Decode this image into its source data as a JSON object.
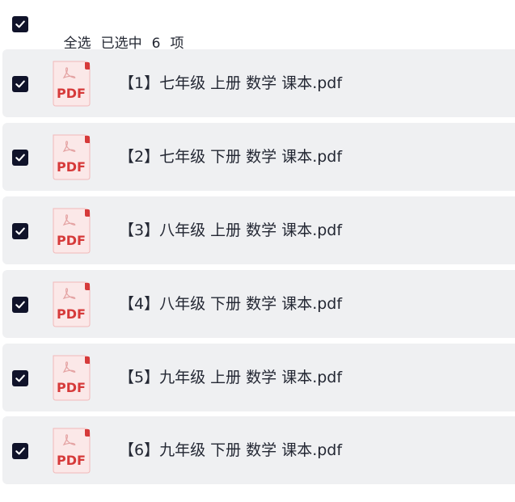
{
  "header": {
    "select_all_label": "全选",
    "selected_prefix": "已选中",
    "selected_count": "6",
    "selected_suffix": "项",
    "select_all_checked": true
  },
  "colors": {
    "checkbox_fill": "#10132a",
    "row_background": "#eff0f2",
    "pdf_red": "#d63a3a"
  },
  "file_icon": {
    "name": "pdf-file-icon",
    "label": "PDF"
  },
  "files": [
    {
      "name": "【1】七年级 上册 数学 课本.pdf",
      "checked": true
    },
    {
      "name": "【2】七年级 下册 数学 课本.pdf",
      "checked": true
    },
    {
      "name": "【3】八年级 上册 数学 课本.pdf",
      "checked": true
    },
    {
      "name": "【4】八年级 下册 数学 课本.pdf",
      "checked": true
    },
    {
      "name": "【5】九年级 上册 数学 课本.pdf",
      "checked": true
    },
    {
      "name": "【6】九年级 下册 数学 课本.pdf",
      "checked": true
    }
  ]
}
